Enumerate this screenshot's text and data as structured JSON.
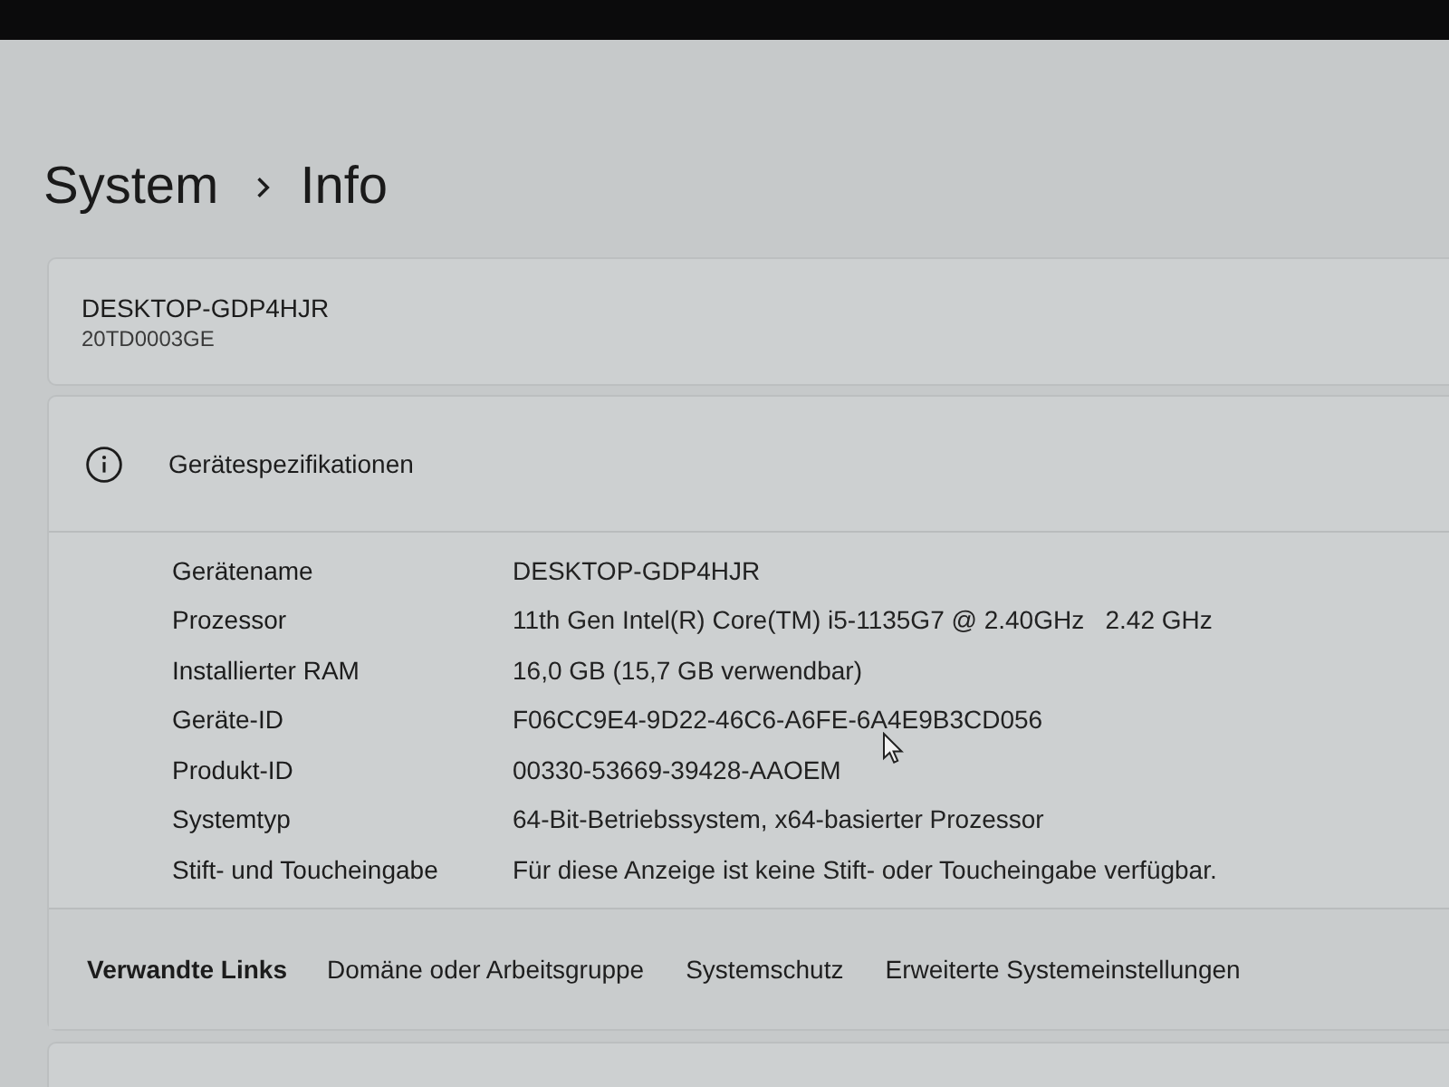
{
  "breadcrumb": [
    {
      "label": "System"
    },
    {
      "label": "Info"
    }
  ],
  "device": {
    "name": "DESKTOP-GDP4HJR",
    "model": "20TD0003GE"
  },
  "specs": {
    "title": "Gerätespezifikationen",
    "rows": [
      {
        "label": "Gerätename",
        "value": "DESKTOP-GDP4HJR"
      },
      {
        "label": "Prozessor",
        "value": "11th Gen Intel(R) Core(TM) i5-1135G7 @ 2.40GHz   2.42 GHz"
      },
      {
        "label": "Installierter RAM",
        "value": "16,0 GB (15,7 GB verwendbar)"
      },
      {
        "label": "Geräte-ID",
        "value": "F06CC9E4-9D22-46C6-A6FE-6A4E9B3CD056"
      },
      {
        "label": "Produkt-ID",
        "value": "00330-53669-39428-AAOEM"
      },
      {
        "label": "Systemtyp",
        "value": "64-Bit-Betriebssystem, x64-basierter Prozessor"
      },
      {
        "label": "Stift- und Toucheingabe",
        "value": "Für diese Anzeige ist keine Stift- oder Toucheingabe verfügbar."
      }
    ]
  },
  "related_links": {
    "title": "Verwandte Links",
    "links": [
      "Domäne oder Arbeitsgruppe",
      "Systemschutz",
      "Erweiterte Systemeinstellungen"
    ]
  }
}
